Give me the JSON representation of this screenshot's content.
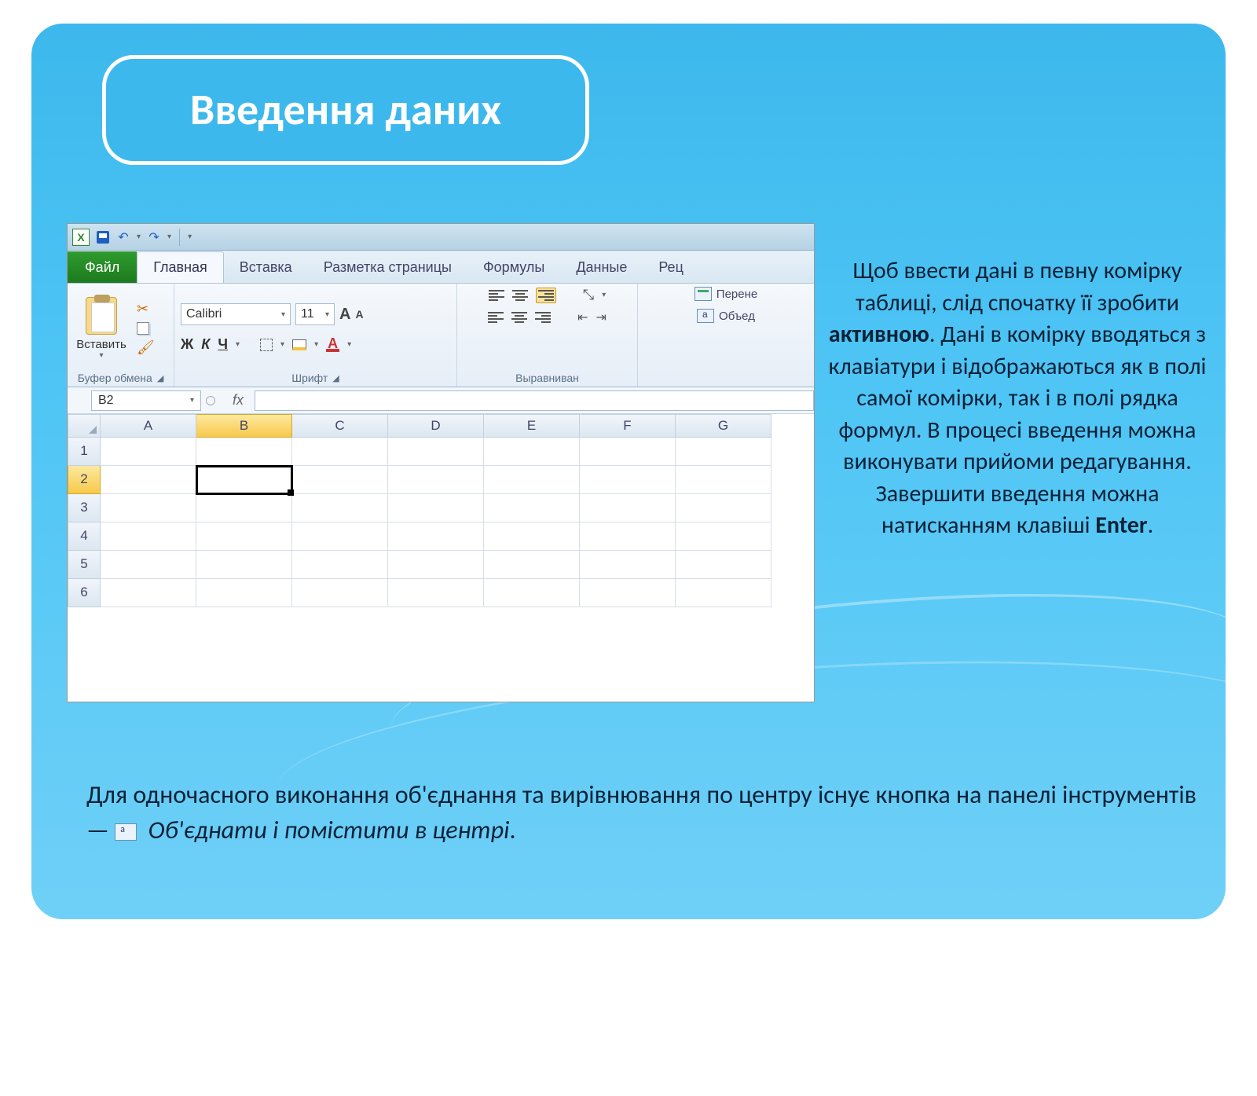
{
  "slide": {
    "title": "Введення даних",
    "body_pre": "Щоб ввести дані в певну комірку таблиці, слід спочатку її зробити ",
    "body_bold1": "активною",
    "body_mid": ". Дані в комірку вводяться з клавіатури і відображаються як в полі самої комірки, так і в полі рядка формул. В процесі введення можна виконувати прийоми редагування. Завершити введення можна натисканням клавіші ",
    "body_bold2": "Enter",
    "body_post": ".",
    "bottom_line1": "Для одночасного виконання об'єднання та вирівнювання по центру існує кнопка на панелі інструментів — ",
    "bottom_italic": "Об'єднати і помістити в центрі",
    "bottom_end": "."
  },
  "excel": {
    "tabs": {
      "file": "Файл",
      "home": "Главная",
      "insert": "Вставка",
      "layout": "Разметка страницы",
      "formulas": "Формулы",
      "data": "Данные",
      "review": "Рец"
    },
    "ribbon": {
      "paste": "Вставить",
      "clipboard_label": "Буфер обмена",
      "font_name": "Calibri",
      "font_size": "11",
      "font_label": "Шрифт",
      "align_label": "Выравниван",
      "wrap": "Перене",
      "merge": "Объед"
    },
    "name_box": "B2",
    "fx": "fx",
    "columns": [
      "A",
      "B",
      "C",
      "D",
      "E",
      "F",
      "G"
    ],
    "rows": [
      "1",
      "2",
      "3",
      "4",
      "5",
      "6"
    ],
    "active_col_index": 1,
    "active_row_index": 1,
    "bold": "Ж",
    "italic": "К",
    "underline": "Ч",
    "font_color_A": "A",
    "grow_A": "A",
    "shrink_A": "A"
  }
}
